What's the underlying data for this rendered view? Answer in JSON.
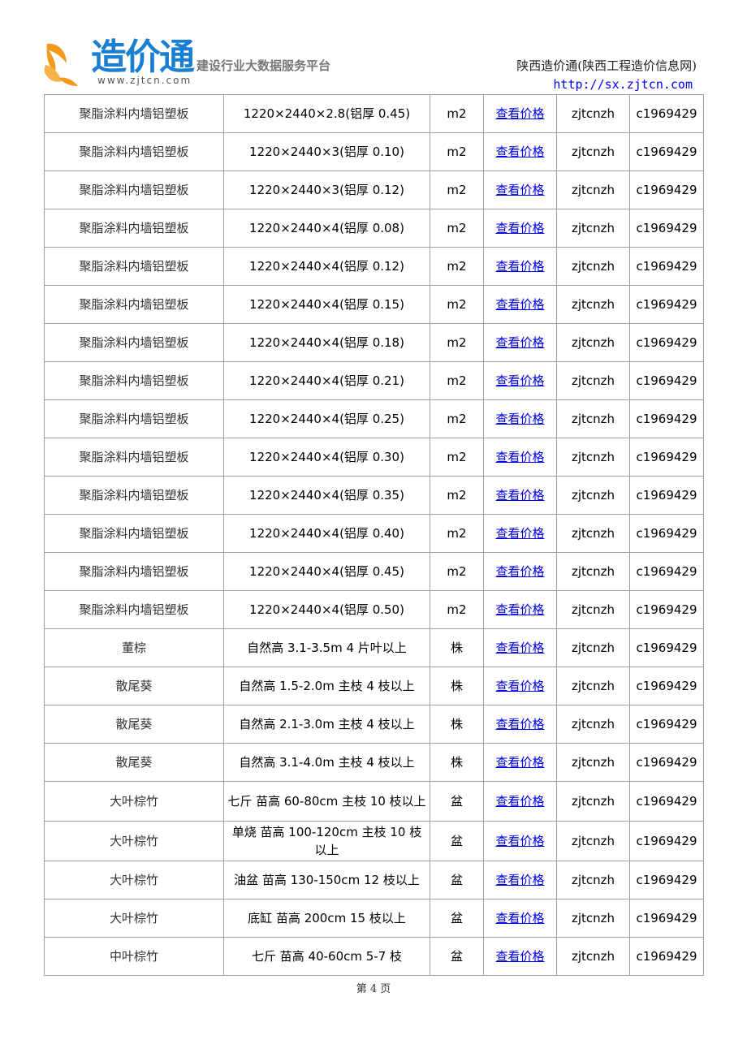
{
  "header": {
    "logo_text": "造价通",
    "logo_url": "www.zjtcn.com",
    "slogan": "建设行业大数据服务平台",
    "site_title": "陕西造价通(陕西工程造价信息网)",
    "site_url": "http://sx.zjtcn.com",
    "logo_color": "#1a7fd0",
    "logo_mark_color": "#f39a1e"
  },
  "table": {
    "link_color": "#0000ee",
    "rows": [
      {
        "name": "聚脂涂料内墙铝塑板",
        "spec": "1220×2440×2.8(铝厚 0.45)",
        "unit": "m2",
        "link": "查看价格",
        "source": "zjtcnzh",
        "code": "c1969429"
      },
      {
        "name": "聚脂涂料内墙铝塑板",
        "spec": "1220×2440×3(铝厚 0.10)",
        "unit": "m2",
        "link": "查看价格",
        "source": "zjtcnzh",
        "code": "c1969429"
      },
      {
        "name": "聚脂涂料内墙铝塑板",
        "spec": "1220×2440×3(铝厚 0.12)",
        "unit": "m2",
        "link": "查看价格",
        "source": "zjtcnzh",
        "code": "c1969429"
      },
      {
        "name": "聚脂涂料内墙铝塑板",
        "spec": "1220×2440×4(铝厚 0.08)",
        "unit": "m2",
        "link": "查看价格",
        "source": "zjtcnzh",
        "code": "c1969429"
      },
      {
        "name": "聚脂涂料内墙铝塑板",
        "spec": "1220×2440×4(铝厚 0.12)",
        "unit": "m2",
        "link": "查看价格",
        "source": "zjtcnzh",
        "code": "c1969429"
      },
      {
        "name": "聚脂涂料内墙铝塑板",
        "spec": "1220×2440×4(铝厚 0.15)",
        "unit": "m2",
        "link": "查看价格",
        "source": "zjtcnzh",
        "code": "c1969429"
      },
      {
        "name": "聚脂涂料内墙铝塑板",
        "spec": "1220×2440×4(铝厚 0.18)",
        "unit": "m2",
        "link": "查看价格",
        "source": "zjtcnzh",
        "code": "c1969429"
      },
      {
        "name": "聚脂涂料内墙铝塑板",
        "spec": "1220×2440×4(铝厚 0.21)",
        "unit": "m2",
        "link": "查看价格",
        "source": "zjtcnzh",
        "code": "c1969429"
      },
      {
        "name": "聚脂涂料内墙铝塑板",
        "spec": "1220×2440×4(铝厚 0.25)",
        "unit": "m2",
        "link": "查看价格",
        "source": "zjtcnzh",
        "code": "c1969429"
      },
      {
        "name": "聚脂涂料内墙铝塑板",
        "spec": "1220×2440×4(铝厚 0.30)",
        "unit": "m2",
        "link": "查看价格",
        "source": "zjtcnzh",
        "code": "c1969429"
      },
      {
        "name": "聚脂涂料内墙铝塑板",
        "spec": "1220×2440×4(铝厚 0.35)",
        "unit": "m2",
        "link": "查看价格",
        "source": "zjtcnzh",
        "code": "c1969429"
      },
      {
        "name": "聚脂涂料内墙铝塑板",
        "spec": "1220×2440×4(铝厚 0.40)",
        "unit": "m2",
        "link": "查看价格",
        "source": "zjtcnzh",
        "code": "c1969429"
      },
      {
        "name": "聚脂涂料内墙铝塑板",
        "spec": "1220×2440×4(铝厚 0.45)",
        "unit": "m2",
        "link": "查看价格",
        "source": "zjtcnzh",
        "code": "c1969429"
      },
      {
        "name": "聚脂涂料内墙铝塑板",
        "spec": "1220×2440×4(铝厚 0.50)",
        "unit": "m2",
        "link": "查看价格",
        "source": "zjtcnzh",
        "code": "c1969429"
      },
      {
        "name": "董棕",
        "spec": "自然高 3.1-3.5m 4 片叶以上",
        "unit": "株",
        "link": "查看价格",
        "source": "zjtcnzh",
        "code": "c1969429"
      },
      {
        "name": "散尾葵",
        "spec": "自然高 1.5-2.0m  主枝 4 枝以上",
        "unit": "株",
        "link": "查看价格",
        "source": "zjtcnzh",
        "code": "c1969429"
      },
      {
        "name": "散尾葵",
        "spec": "自然高 2.1-3.0m  主枝 4 枝以上",
        "unit": "株",
        "link": "查看价格",
        "source": "zjtcnzh",
        "code": "c1969429"
      },
      {
        "name": "散尾葵",
        "spec": "自然高 3.1-4.0m  主枝 4 枝以上",
        "unit": "株",
        "link": "查看价格",
        "source": "zjtcnzh",
        "code": "c1969429"
      },
      {
        "name": "大叶棕竹",
        "spec": "七斤  苗高 60-80cm  主枝 10 枝以上",
        "unit": "盆",
        "link": "查看价格",
        "source": "zjtcnzh",
        "code": "c1969429"
      },
      {
        "name": "大叶棕竹",
        "spec": "单烧  苗高 100-120cm  主枝 10 枝以上",
        "unit": "盆",
        "link": "查看价格",
        "source": "zjtcnzh",
        "code": "c1969429"
      },
      {
        "name": "大叶棕竹",
        "spec": "油盆  苗高 130-150cm 12 枝以上",
        "unit": "盆",
        "link": "查看价格",
        "source": "zjtcnzh",
        "code": "c1969429"
      },
      {
        "name": "大叶棕竹",
        "spec": "底缸  苗高 200cm 15 枝以上",
        "unit": "盆",
        "link": "查看价格",
        "source": "zjtcnzh",
        "code": "c1969429"
      },
      {
        "name": "中叶棕竹",
        "spec": "七斤  苗高 40-60cm 5-7 枝",
        "unit": "盆",
        "link": "查看价格",
        "source": "zjtcnzh",
        "code": "c1969429"
      }
    ]
  },
  "footer": {
    "page_label": "第 4 页"
  }
}
